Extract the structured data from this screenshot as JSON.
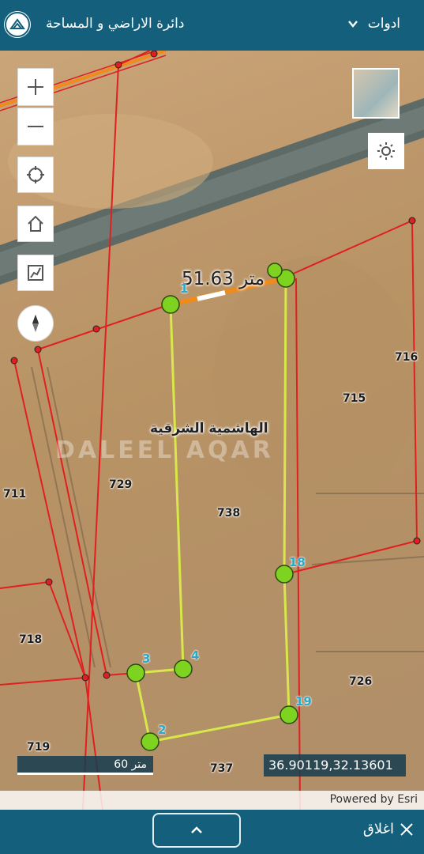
{
  "header": {
    "title": "دائرة الاراضي و المساحة",
    "tools_label": "ادوات"
  },
  "map": {
    "measurement": "51.63 متر",
    "area_name": "الهاشمية الشرقية",
    "watermark": "DALEEL AQAR",
    "parcels": [
      "716",
      "715",
      "729",
      "711",
      "738",
      "718",
      "726",
      "719",
      "737"
    ],
    "vertex_labels": [
      "1",
      "2",
      "3",
      "4",
      "18",
      "19"
    ],
    "scale_label": "60 متر",
    "coordinates": "36.90119,32.13601",
    "attribution": "Powered by Esri"
  },
  "footer": {
    "close_label": "اغلاق"
  },
  "colors": {
    "bar": "#14607c",
    "parcel_line": "#e02020",
    "selection_line": "#d8e84a",
    "vertex": "#7ed321",
    "measure_line": "#f08a1a",
    "vertex_label": "#2aa8c8"
  }
}
